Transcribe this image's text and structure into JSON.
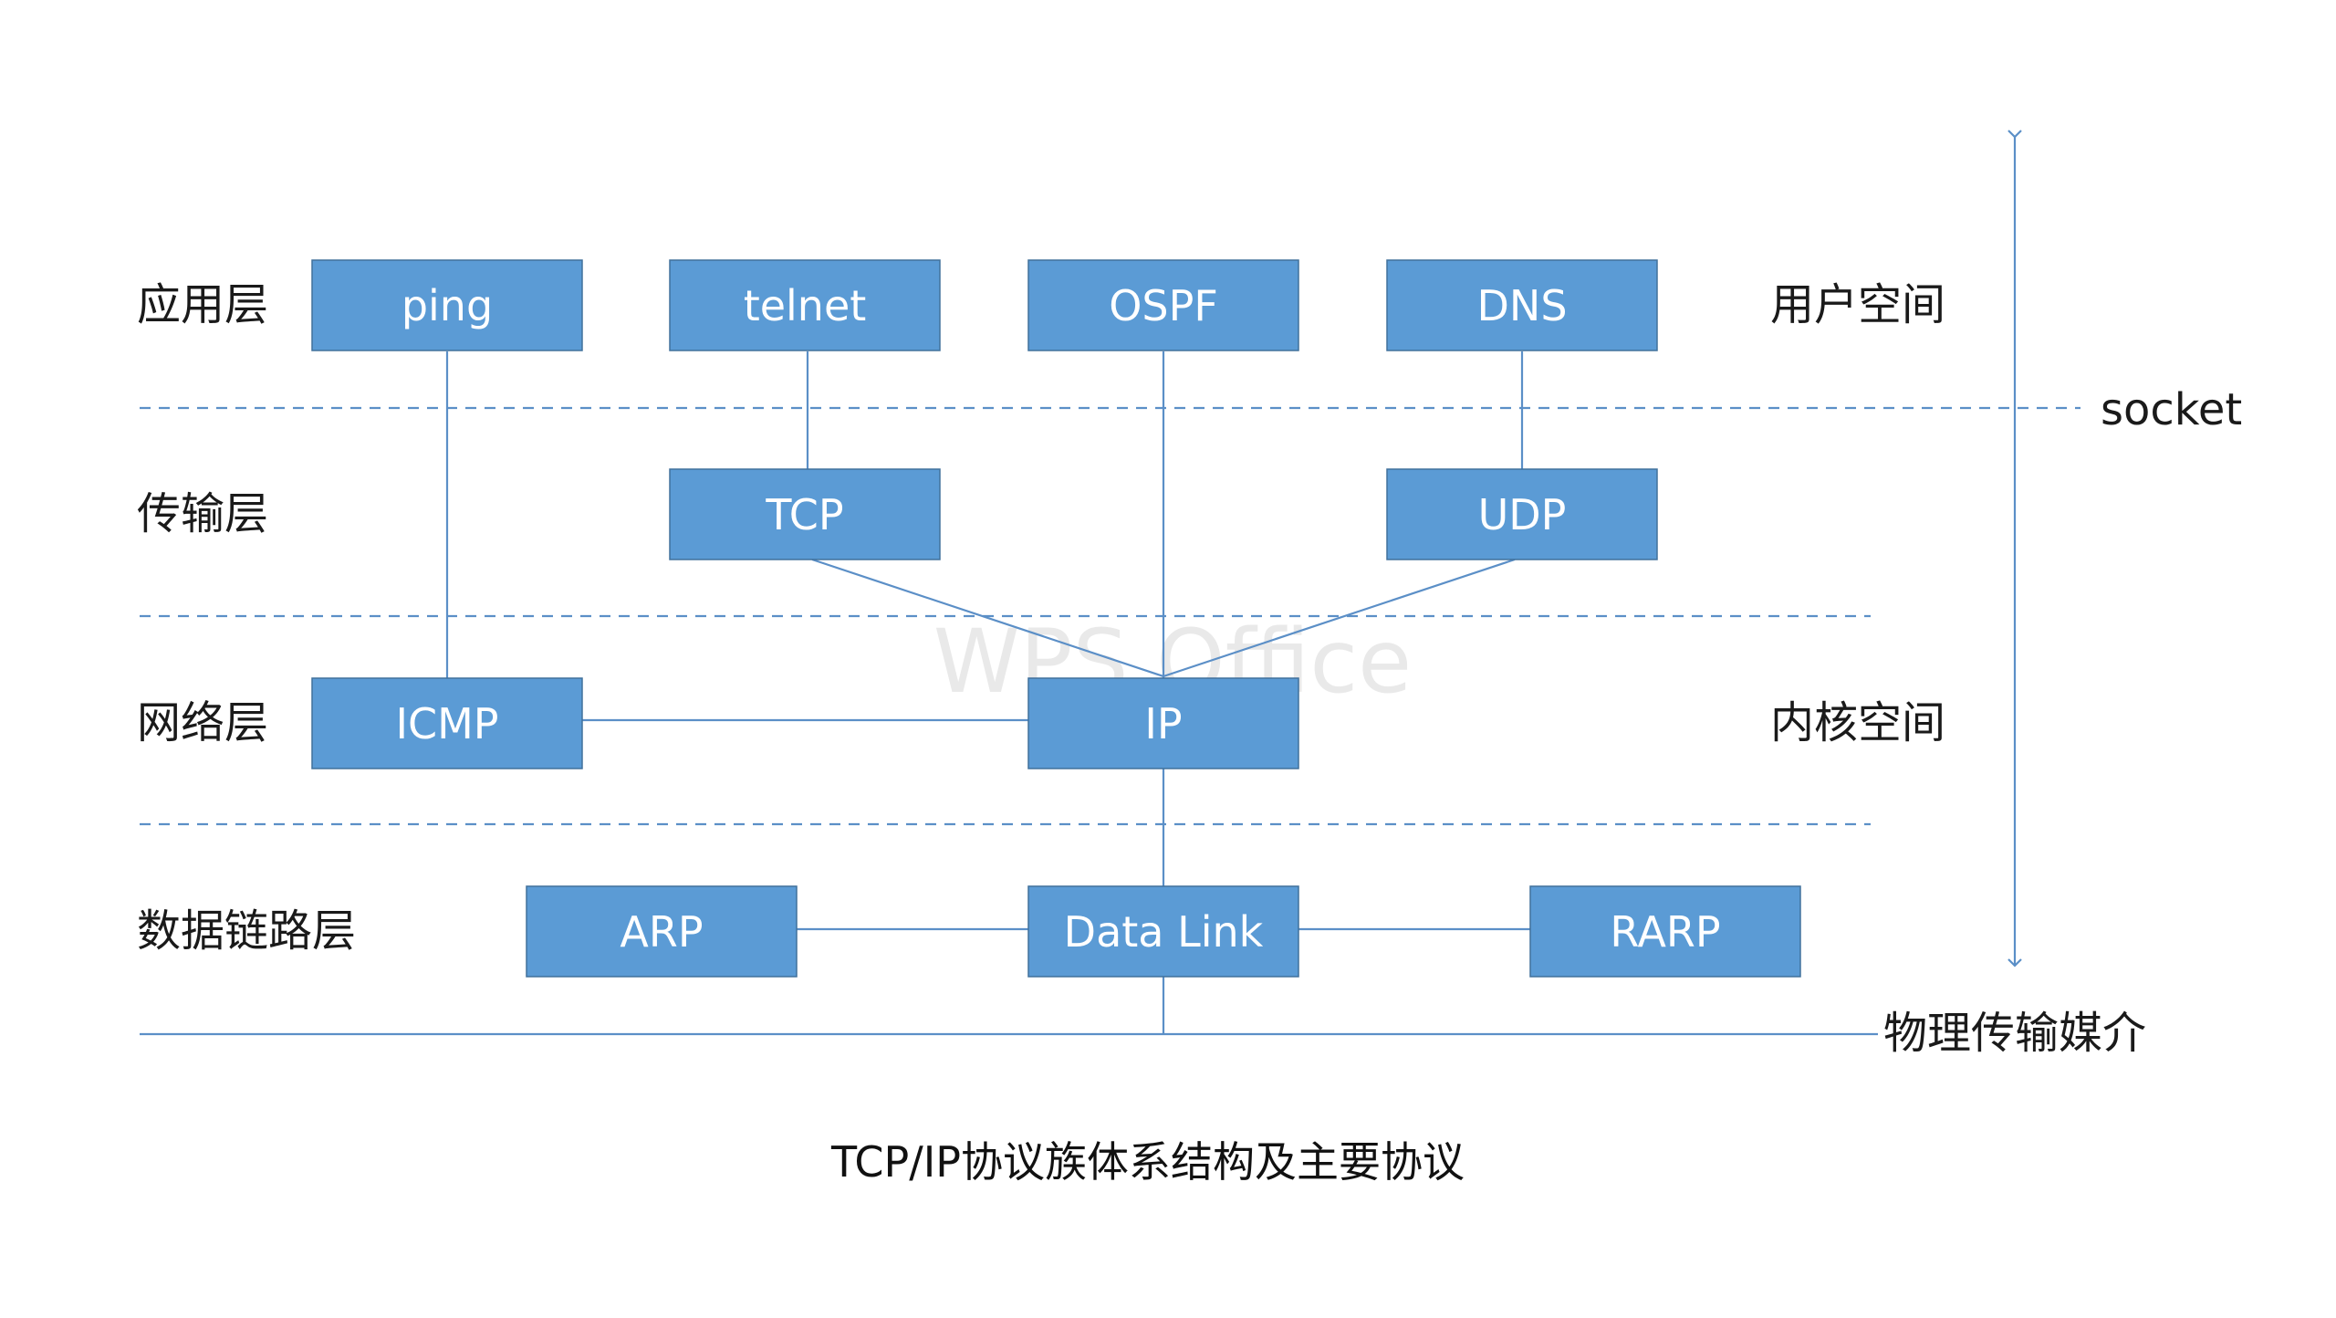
{
  "layers": {
    "app": "应用层",
    "transport": "传输层",
    "network": "网络层",
    "datalink": "数据链路层"
  },
  "boxes": {
    "ping": "ping",
    "telnet": "telnet",
    "ospf": "OSPF",
    "dns": "DNS",
    "tcp": "TCP",
    "udp": "UDP",
    "icmp": "ICMP",
    "ip": "IP",
    "arp": "ARP",
    "datalink": "Data Link",
    "rarp": "RARP"
  },
  "side": {
    "user_space": "用户空间",
    "socket": "socket",
    "kernel_space": "内核空间",
    "physical_medium": "物理传输媒介"
  },
  "caption": "TCP/IP协议族体系结构及主要协议",
  "watermark": "WPS Office",
  "colors": {
    "box_fill": "#5b9bd5",
    "box_border": "#41719c",
    "line": "#5b8fc7",
    "text": "#1a1a1a"
  }
}
